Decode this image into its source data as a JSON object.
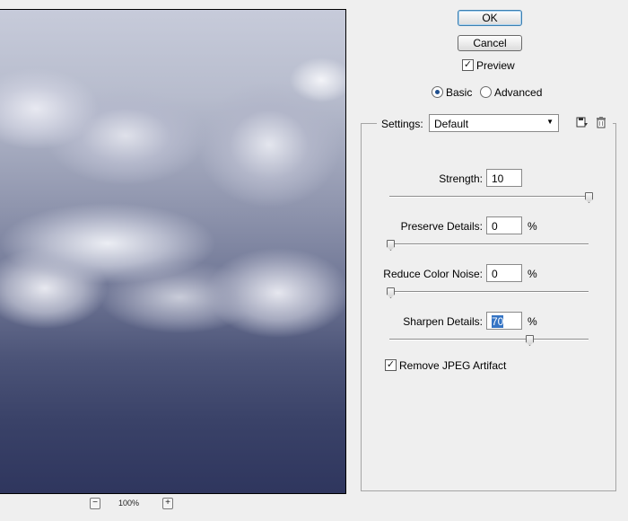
{
  "buttons": {
    "ok": "OK",
    "cancel": "Cancel"
  },
  "preview": {
    "label": "Preview",
    "checked": true
  },
  "mode": {
    "basic": "Basic",
    "advanced": "Advanced",
    "selected": "basic"
  },
  "settings": {
    "label": "Settings:",
    "value": "Default",
    "save_icon": "save-icon",
    "delete_icon": "trash-icon"
  },
  "controls": {
    "strength": {
      "label": "Strength:",
      "value": "10",
      "max": 10
    },
    "preserve": {
      "label": "Preserve Details:",
      "value": "0",
      "unit": "%"
    },
    "noise": {
      "label": "Reduce Color Noise:",
      "value": "0",
      "unit": "%"
    },
    "sharpen": {
      "label": "Sharpen Details:",
      "value": "70",
      "unit": "%"
    }
  },
  "jpeg": {
    "label": "Remove JPEG Artifact",
    "checked": true
  },
  "zoom": {
    "minus": "−",
    "plus": "+",
    "value": "100%"
  }
}
